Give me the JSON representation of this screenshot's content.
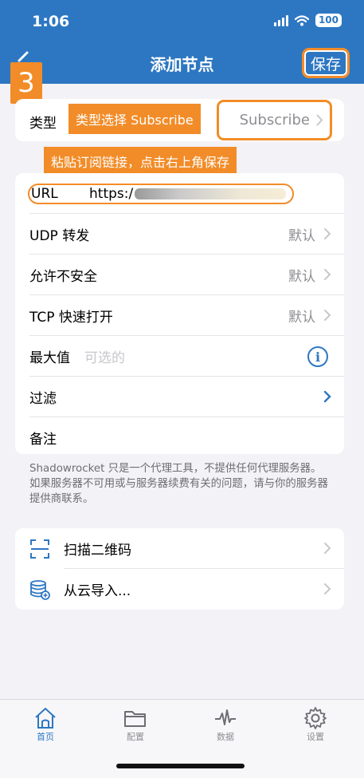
{
  "status_bar": {
    "time": "1:06",
    "battery": "100"
  },
  "nav": {
    "title": "添加节点",
    "save_label": "保存"
  },
  "step_badge": "3",
  "type_row": {
    "label": "类型",
    "value": "Subscribe",
    "hint": "类型选择 Subscribe"
  },
  "paste_hint": "粘贴订阅链接，点击右上角保存",
  "url_row": {
    "label": "URL",
    "value_prefix": "https:/"
  },
  "rows": [
    {
      "label": "UDP 转发",
      "value": "默认"
    },
    {
      "label": "允许不安全",
      "value": "默认"
    },
    {
      "label": "TCP 快速打开",
      "value": "默认"
    },
    {
      "label": "最大值",
      "placeholder": "可选的"
    },
    {
      "label": "过滤"
    },
    {
      "label": "备注"
    }
  ],
  "footnote": "Shadowrocket 只是一个代理工具，不提供任何代理服务器。如果服务器不可用或与服务器续费有关的问题，请与你的服务器提供商联系。",
  "actions": [
    {
      "label": "扫描二维码",
      "icon": "qr-scan-icon"
    },
    {
      "label": "从云导入...",
      "icon": "cloud-database-icon"
    }
  ],
  "tabs": [
    {
      "label": "首页",
      "icon": "home-icon",
      "active": true
    },
    {
      "label": "配置",
      "icon": "folder-icon"
    },
    {
      "label": "数据",
      "icon": "pulse-icon"
    },
    {
      "label": "设置",
      "icon": "gear-icon"
    }
  ],
  "colors": {
    "header": "#2d77c2",
    "annotation": "#f28c28",
    "accent": "#2d77c2"
  }
}
